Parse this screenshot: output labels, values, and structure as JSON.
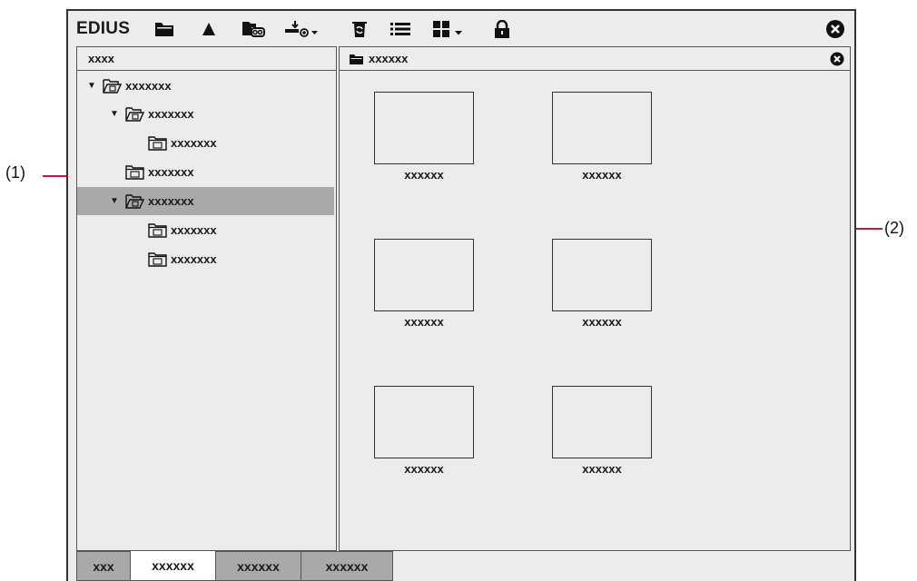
{
  "app": {
    "logo": "EDIUS"
  },
  "toolbar": {
    "icons": [
      "folder-icon",
      "up-arrow-icon",
      "folder-link-icon",
      "add-clip-dropdown-icon",
      "recycle-icon",
      "list-view-icon",
      "thumbnail-view-dropdown-icon",
      "lock-icon"
    ]
  },
  "left_panel": {
    "header": "xxxx",
    "tree": [
      {
        "label": "xxxxxxx",
        "depth": 0,
        "expanded": true,
        "selected": false
      },
      {
        "label": "xxxxxxx",
        "depth": 1,
        "expanded": true,
        "selected": false
      },
      {
        "label": "xxxxxxx",
        "depth": 2,
        "expanded": false,
        "selected": false
      },
      {
        "label": "xxxxxxx",
        "depth": 1,
        "expanded": false,
        "selected": false
      },
      {
        "label": "xxxxxxx",
        "depth": 1,
        "expanded": true,
        "selected": true
      },
      {
        "label": "xxxxxxx",
        "depth": 2,
        "expanded": false,
        "selected": false
      },
      {
        "label": "xxxxxxx",
        "depth": 2,
        "expanded": false,
        "selected": false
      }
    ]
  },
  "right_panel": {
    "header": "xxxxxx",
    "clips": [
      "xxxxxx",
      "xxxxxx",
      "xxxxxx",
      "xxxxxx",
      "xxxxxx",
      "xxxxxx"
    ]
  },
  "tabs": [
    {
      "label": "xxx",
      "active": false
    },
    {
      "label": "xxxxxx",
      "active": true
    },
    {
      "label": "xxxxxx",
      "active": false
    },
    {
      "label": "xxxxxx",
      "active": false
    }
  ],
  "callouts": {
    "left": "(1)",
    "right": "(2)"
  },
  "colors": {
    "selection": "#a9a9a9",
    "callout_line": "#d0142c",
    "panel_bg": "#ececec"
  }
}
